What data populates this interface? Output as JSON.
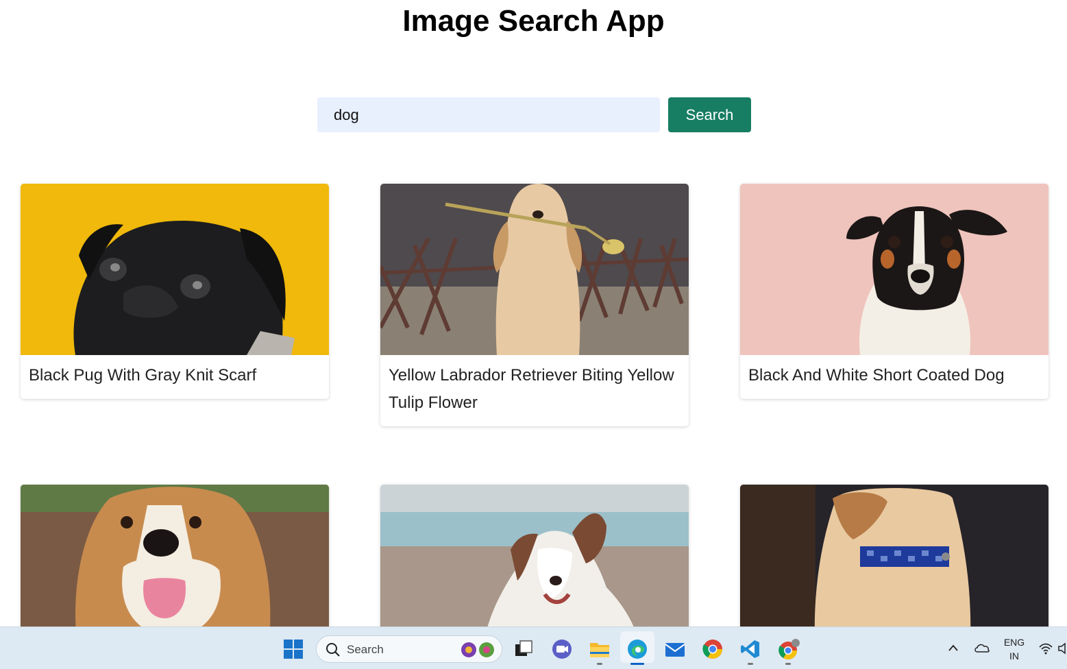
{
  "app": {
    "title": "Image Search App"
  },
  "search": {
    "value": "dog",
    "button_label": "Search"
  },
  "results": [
    {
      "caption": "Black Pug With Gray Knit Scarf"
    },
    {
      "caption": "Yellow Labrador Retriever Biting Yellow Tulip Flower"
    },
    {
      "caption": "Black And White Short Coated Dog"
    },
    {
      "caption": ""
    },
    {
      "caption": ""
    },
    {
      "caption": ""
    }
  ],
  "taskbar": {
    "search_label": "Search",
    "language_line1": "ENG",
    "language_line2": "IN",
    "icons": [
      "windows-start-icon",
      "search-icon",
      "task-view-icon",
      "teams-meet-icon",
      "file-explorer-icon",
      "edge-icon",
      "mail-icon",
      "chrome-icon",
      "vscode-icon",
      "chrome-profile-icon",
      "chevron-up-icon",
      "onedrive-cloud-icon",
      "wifi-icon",
      "speaker-icon"
    ]
  },
  "colors": {
    "accent": "#177e63",
    "input_bg": "#e8f0fe",
    "taskbar_bg": "#dde9f3"
  }
}
